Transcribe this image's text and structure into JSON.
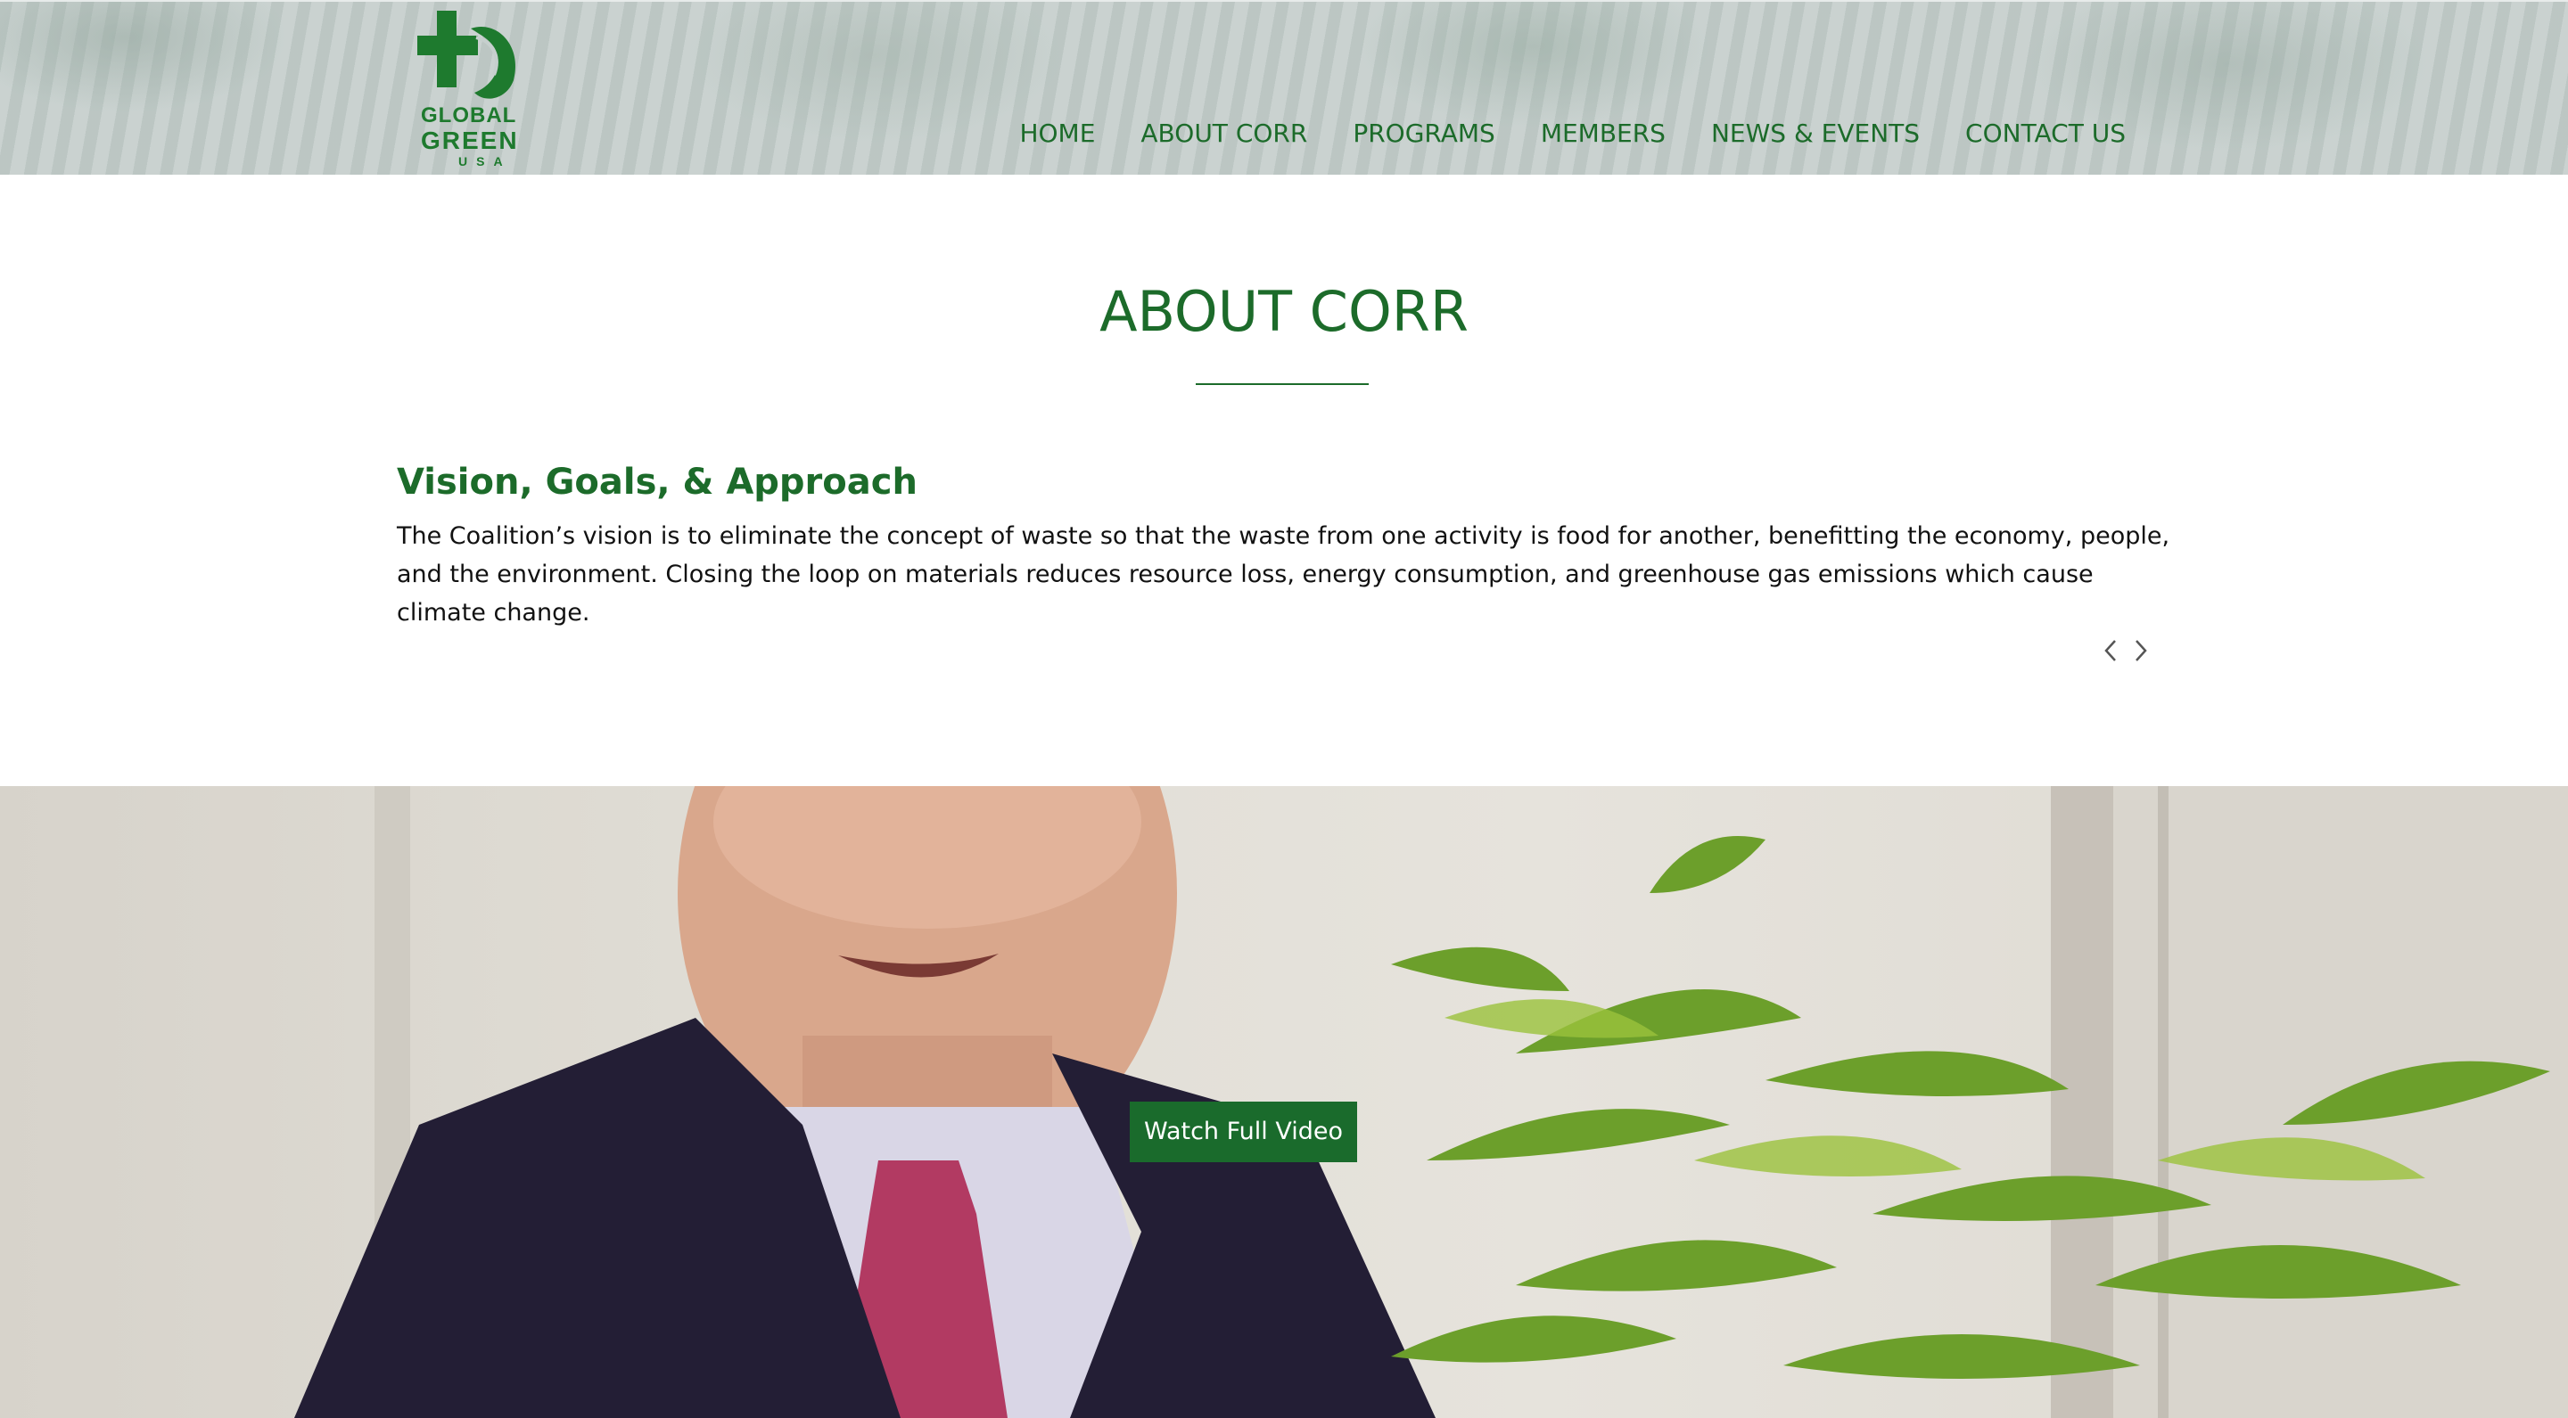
{
  "brand": {
    "logo_line1": "GLOBAL",
    "logo_line2": "GREEN",
    "logo_line3": "USA",
    "color_primary": "#1c6b2a"
  },
  "nav": {
    "items": [
      {
        "label": "HOME"
      },
      {
        "label": "ABOUT CORR"
      },
      {
        "label": "PROGRAMS"
      },
      {
        "label": "MEMBERS"
      },
      {
        "label": "NEWS & EVENTS"
      },
      {
        "label": "CONTACT US"
      }
    ]
  },
  "main": {
    "title": "ABOUT CORR",
    "section": {
      "heading": "Vision, Goals, & Approach",
      "body": "The Coalition’s vision is to eliminate the concept of waste so that the waste from one activity is food for another, benefitting the economy, people, and the environment. Closing the loop on materials reduces resource loss, energy consumption, and greenhouse gas emissions which cause climate change."
    },
    "pager": {
      "prev_icon": "chevron-left-icon",
      "next_icon": "chevron-right-icon"
    }
  },
  "video": {
    "button_label": "Watch Full Video",
    "button_color": "#1a6b2c"
  }
}
